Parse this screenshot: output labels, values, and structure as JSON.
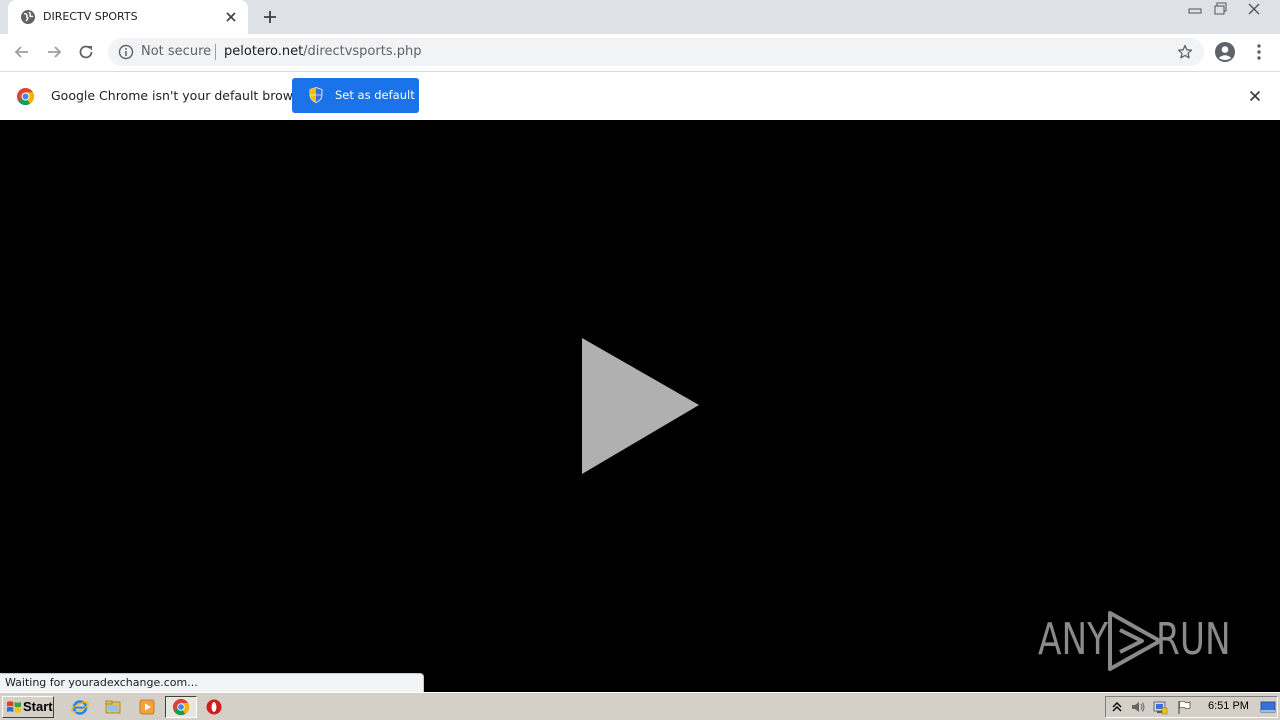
{
  "tab": {
    "title": "DIRECTV SPORTS",
    "favicon": "globe-icon",
    "close_icon": "close-icon"
  },
  "new_tab_icon": "plus-icon",
  "window_controls": [
    "minimize-icon",
    "restore-icon",
    "close-icon"
  ],
  "toolbar": {
    "back_icon": "arrow-left-icon",
    "forward_icon": "arrow-right-icon",
    "reload_icon": "reload-icon",
    "security_label": "Not secure",
    "url_host": "pelotero.net",
    "url_path": "/directvsports.php",
    "bookmark_icon": "star-icon",
    "profile_icon": "account-icon",
    "menu_icon": "kebab-menu-icon"
  },
  "infobar": {
    "message": "Google Chrome isn't your default browser",
    "button_label": "Set as default",
    "accent": "#1a73e8"
  },
  "content": {
    "play_icon": "play-icon",
    "watermark_left": "ANY",
    "watermark_right": "RUN",
    "status_text": "Waiting for youradexchange.com..."
  },
  "taskbar": {
    "start_label": "Start",
    "pinned": [
      "internet-explorer-icon",
      "file-explorer-icon",
      "media-player-icon",
      "chrome-icon",
      "opera-icon"
    ],
    "clock": "6:51 PM"
  },
  "colors": {
    "tabstrip": "#dee1e6",
    "content_bg": "#000000",
    "play_fill": "#b0b0b0",
    "taskbar": "#d4d0c8"
  }
}
